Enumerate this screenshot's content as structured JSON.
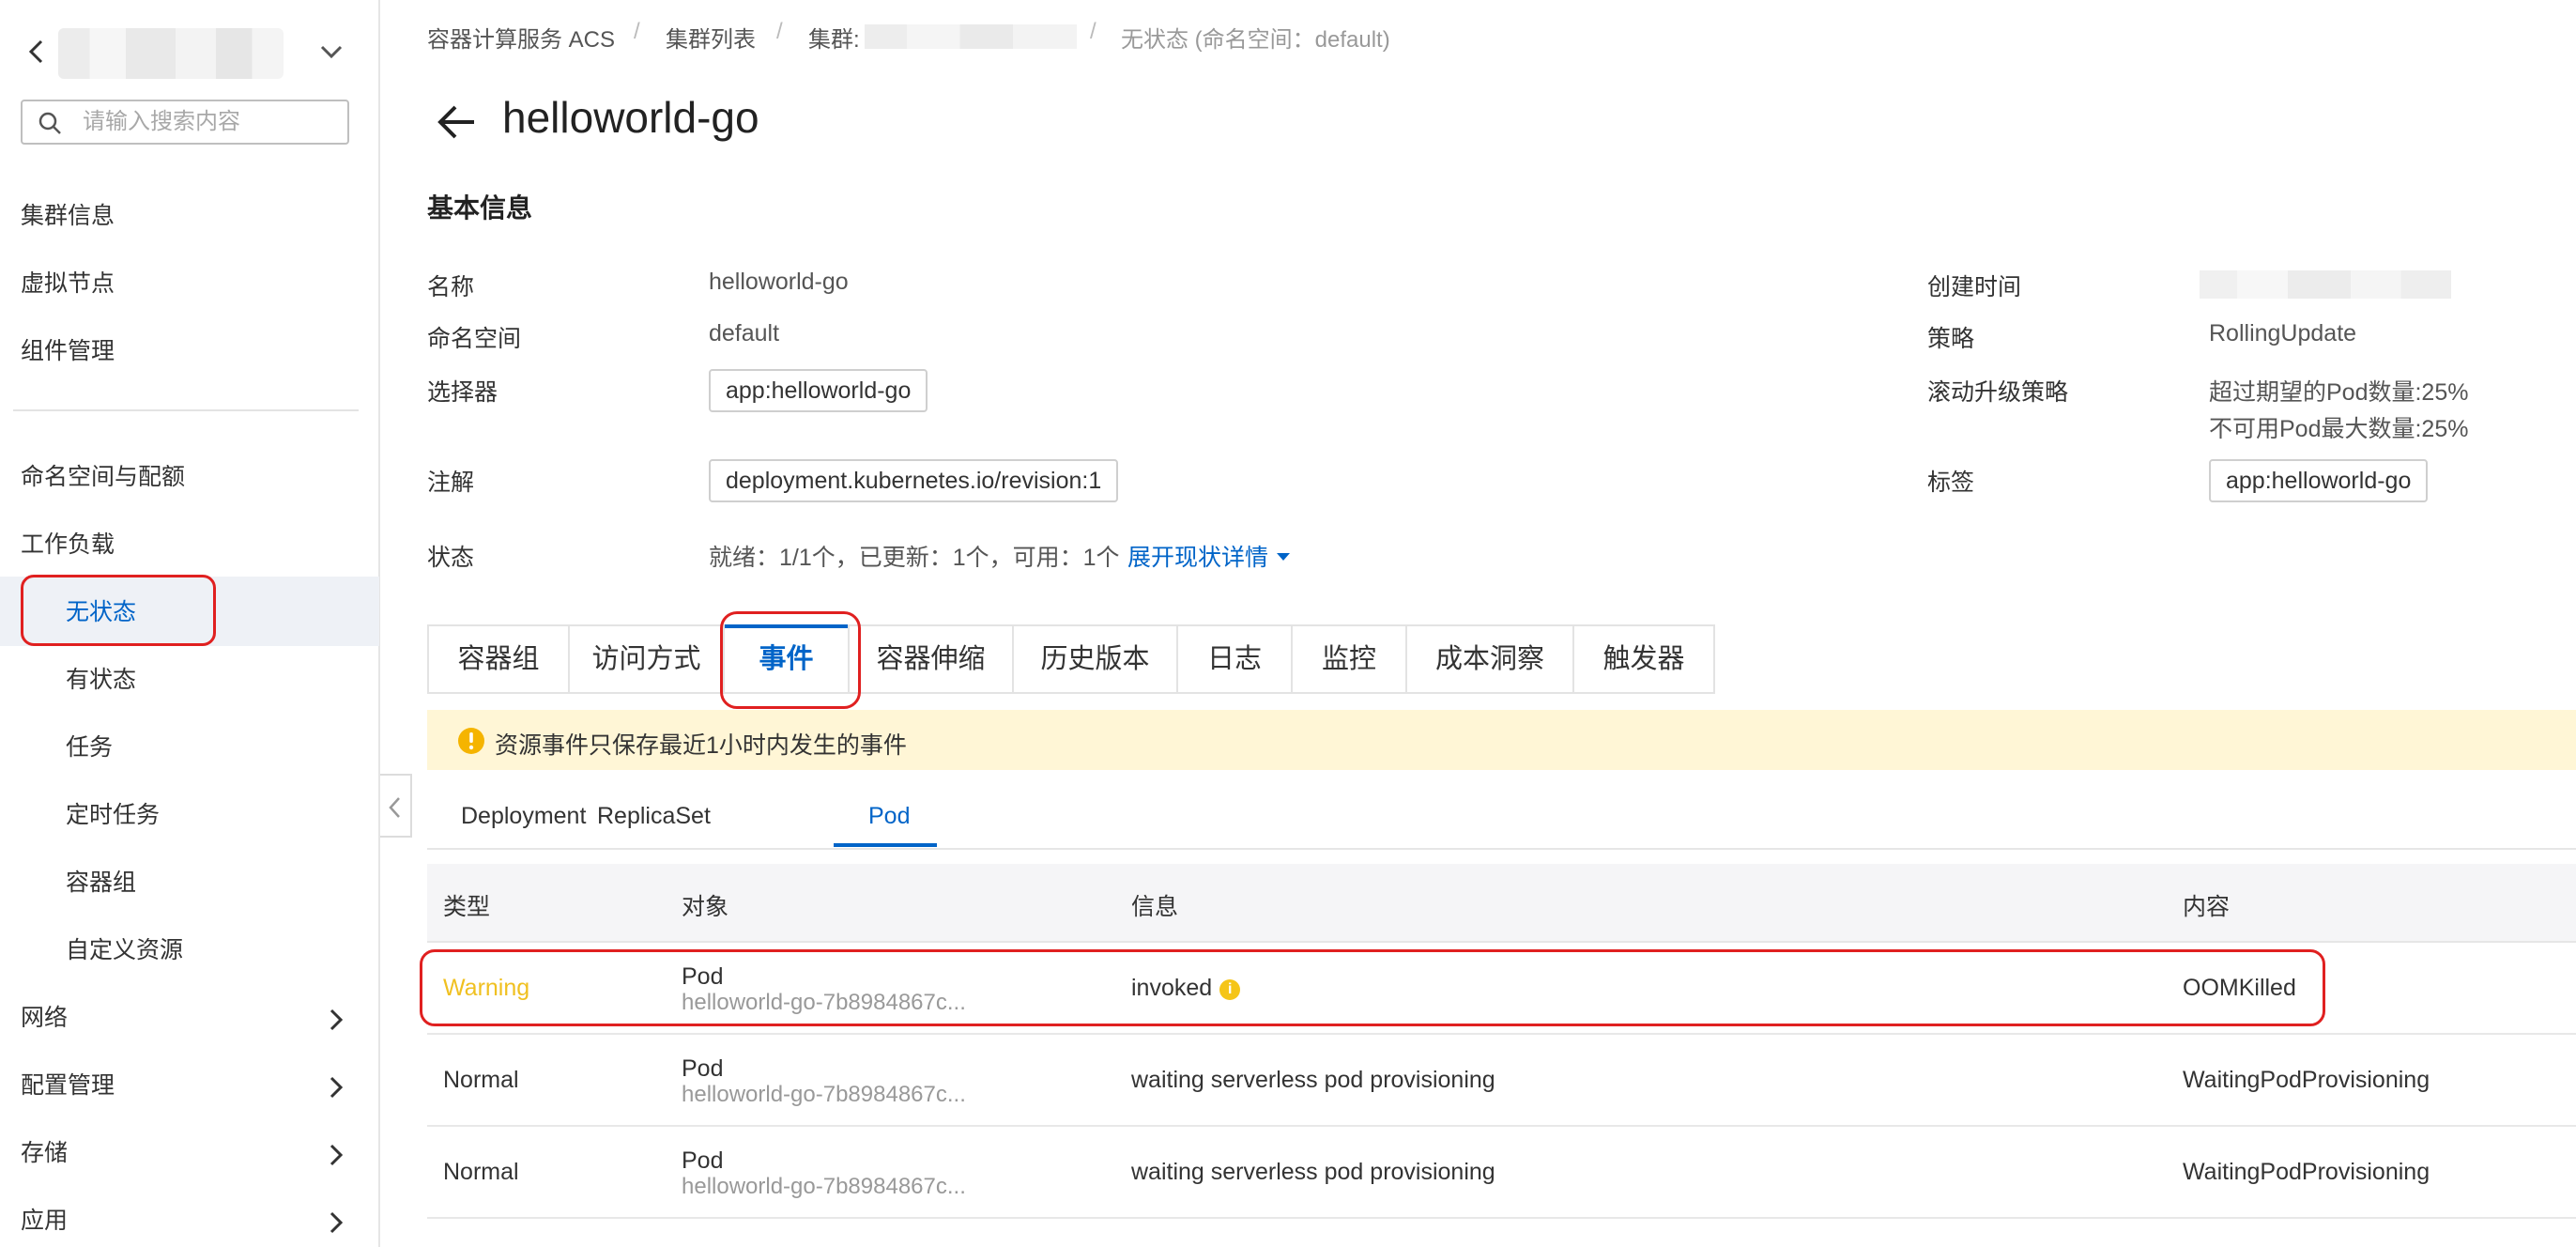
{
  "sidebar": {
    "search_placeholder": "请输入搜索内容",
    "items": [
      {
        "label": "集群信息"
      },
      {
        "label": "虚拟节点"
      },
      {
        "label": "组件管理"
      },
      {
        "label": "命名空间与配额"
      },
      {
        "label": "工作负载"
      },
      {
        "label": "无状态",
        "active": true
      },
      {
        "label": "有状态"
      },
      {
        "label": "任务"
      },
      {
        "label": "定时任务"
      },
      {
        "label": "容器组"
      },
      {
        "label": "自定义资源"
      },
      {
        "label": "网络",
        "expandable": true
      },
      {
        "label": "配置管理",
        "expandable": true
      },
      {
        "label": "存储",
        "expandable": true
      },
      {
        "label": "应用",
        "expandable": true
      }
    ]
  },
  "breadcrumb": {
    "items": [
      "容器计算服务 ACS",
      "集群列表",
      "集群:",
      "无状态 (命名空间：default)"
    ],
    "separator": "/"
  },
  "page": {
    "title": "helloworld-go",
    "section_title": "基本信息"
  },
  "basic_info": {
    "name_label": "名称",
    "name_value": "helloworld-go",
    "namespace_label": "命名空间",
    "namespace_value": "default",
    "selector_label": "选择器",
    "selector_value": "app:helloworld-go",
    "annotation_label": "注解",
    "annotation_value": "deployment.kubernetes.io/revision:1",
    "status_label": "状态",
    "status_value": "就绪：1/1个，已更新：1个，可用：1个",
    "status_link": "展开现状详情",
    "created_label": "创建时间",
    "strategy_label": "策略",
    "strategy_value": "RollingUpdate",
    "rolling_label": "滚动升级策略",
    "rolling_value_1": "超过期望的Pod数量:25%",
    "rolling_value_2": "不可用Pod最大数量:25%",
    "labels_label": "标签",
    "labels_value": "app:helloworld-go"
  },
  "tabs": [
    {
      "label": "容器组"
    },
    {
      "label": "访问方式"
    },
    {
      "label": "事件",
      "active": true
    },
    {
      "label": "容器伸缩"
    },
    {
      "label": "历史版本"
    },
    {
      "label": "日志"
    },
    {
      "label": "监控"
    },
    {
      "label": "成本洞察"
    },
    {
      "label": "触发器"
    }
  ],
  "notice": {
    "text": "资源事件只保存最近1小时内发生的事件"
  },
  "subtabs": [
    {
      "label": "Deployment"
    },
    {
      "label": "ReplicaSet"
    },
    {
      "label": "Pod",
      "active": true
    }
  ],
  "table": {
    "headers": [
      "类型",
      "对象",
      "信息",
      "内容"
    ],
    "rows": [
      {
        "type": "Warning",
        "object_kind": "Pod",
        "object_name": "helloworld-go-7b8984867c...",
        "info": "invoked",
        "content": "OOMKilled"
      },
      {
        "type": "Normal",
        "object_kind": "Pod",
        "object_name": "helloworld-go-7b8984867c...",
        "info": "waiting serverless pod provisioning",
        "content": "WaitingPodProvisioning"
      },
      {
        "type": "Normal",
        "object_kind": "Pod",
        "object_name": "helloworld-go-7b8984867c...",
        "info": "waiting serverless pod provisioning",
        "content": "WaitingPodProvisioning"
      }
    ]
  },
  "colors": {
    "accent": "#0064c8",
    "warning": "#f0c020",
    "highlight": "#e02020",
    "notice_bg": "#fff6d6"
  }
}
